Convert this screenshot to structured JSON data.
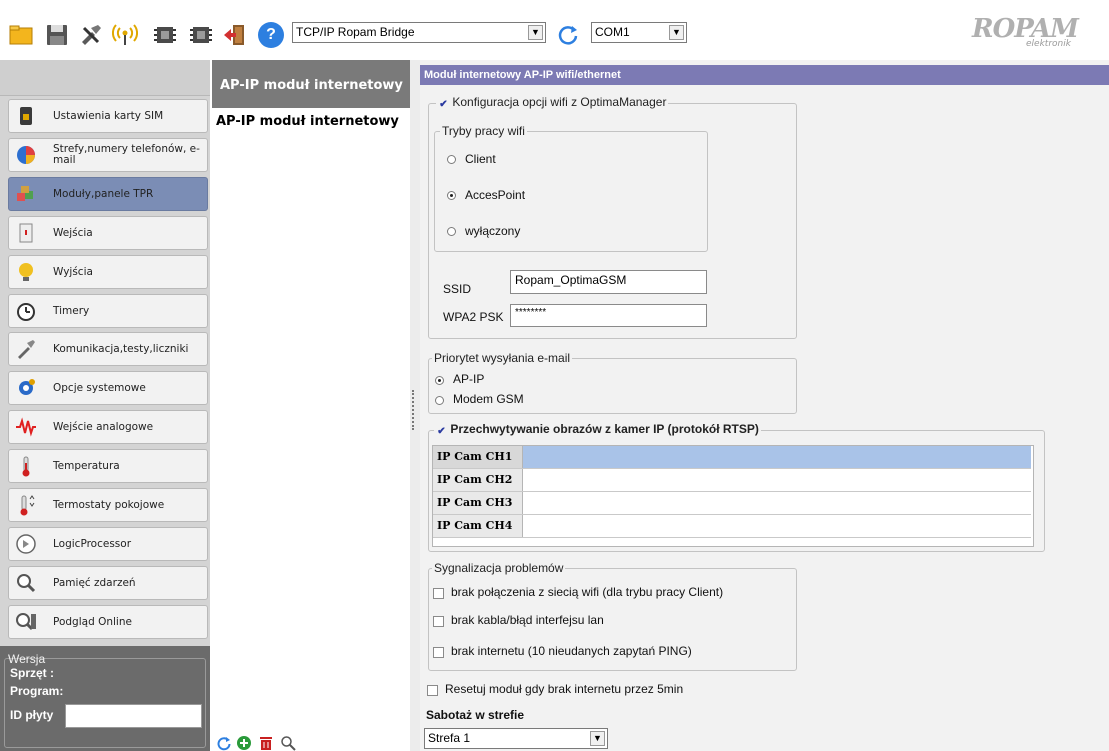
{
  "toolbar": {
    "icons": [
      "open-folder-icon",
      "save-icon",
      "tools-icon",
      "antenna-icon",
      "chip-read-icon",
      "chip-write-icon",
      "exit-icon",
      "help-icon",
      "refresh-icon"
    ],
    "help_glyph": "?",
    "connection_type": "TCP/IP Ropam Bridge",
    "port": "COM1",
    "logo_text": "ROPAM",
    "logo_sub": "elektronik"
  },
  "sidebar": {
    "items": [
      {
        "label": "Ustawienia karty SIM",
        "icon": "sim-card-icon"
      },
      {
        "label": "Strefy,numery telefonów, e-mail",
        "icon": "zones-pie-icon"
      },
      {
        "label": "Moduły,panele TPR",
        "icon": "modules-cubes-icon",
        "active": true
      },
      {
        "label": "Wejścia",
        "icon": "inputs-icon"
      },
      {
        "label": "Wyjścia",
        "icon": "outputs-bulb-icon"
      },
      {
        "label": "Timery",
        "icon": "timer-clock-icon"
      },
      {
        "label": "Komunikacja,testy,liczniki",
        "icon": "communication-tools-icon"
      },
      {
        "label": "Opcje systemowe",
        "icon": "system-gears-icon"
      },
      {
        "label": "Wejście analogowe",
        "icon": "analog-wave-icon"
      },
      {
        "label": "Temperatura",
        "icon": "thermometer-icon"
      },
      {
        "label": "Termostaty pokojowe",
        "icon": "thermostat-icon"
      },
      {
        "label": "LogicProcessor",
        "icon": "logic-processor-icon"
      },
      {
        "label": "Pamięć zdarzeń",
        "icon": "event-memory-icon"
      },
      {
        "label": "Podgląd Online",
        "icon": "online-preview-icon"
      }
    ],
    "version": {
      "legend": "Wersja",
      "hardware": "Sprzęt :",
      "program": "Program:",
      "board_id": "ID płyty",
      "board_id_value": ""
    }
  },
  "middle": {
    "header": "AP-IP moduł internetowy",
    "items": [
      "AP-IP moduł internetowy"
    ],
    "bottom_icons": [
      "refresh-icon",
      "add-icon",
      "delete-icon",
      "search-icon"
    ]
  },
  "main": {
    "header": "Moduł internetowy AP-IP wifi/ethernet",
    "wifi_config": {
      "label": "Konfiguracja opcji wifi z OptimaManager",
      "checked": true,
      "modes_legend": "Tryby pracy wifi",
      "modes": [
        {
          "label": "Client",
          "selected": false
        },
        {
          "label": "AccesPoint",
          "selected": true
        },
        {
          "label": "wyłączony",
          "selected": false
        }
      ],
      "ssid_label": "SSID",
      "ssid_value": "Ropam_OptimaGSM",
      "psk_label": "WPA2 PSK",
      "psk_value": "********"
    },
    "email_priority": {
      "legend": "Priorytet wysyłania e-mail",
      "options": [
        {
          "label": "AP-IP",
          "selected": true
        },
        {
          "label": "Modem GSM",
          "selected": false
        }
      ]
    },
    "cameras": {
      "label": "Przechwytywanie obrazów z kamer IP (protokół RTSP)",
      "checked": true,
      "rows": [
        {
          "label": "IP Cam CH1",
          "value": ""
        },
        {
          "label": "IP Cam CH2",
          "value": ""
        },
        {
          "label": "IP Cam CH3",
          "value": ""
        },
        {
          "label": "IP Cam CH4",
          "value": ""
        }
      ]
    },
    "problems": {
      "legend": "Sygnalizacja problemów",
      "options": [
        {
          "label": "brak połączenia z siecią wifi (dla trybu pracy Client)",
          "checked": false
        },
        {
          "label": "brak kabla/błąd interfejsu lan",
          "checked": false
        },
        {
          "label": "brak internetu (10 nieudanych zapytań PING)",
          "checked": false
        }
      ]
    },
    "reset_label": "Resetuj moduł gdy brak internetu przez  5min",
    "reset_checked": false,
    "sabotage_label": "Sabotaż w strefie",
    "zone_value": "Strefa 1"
  }
}
